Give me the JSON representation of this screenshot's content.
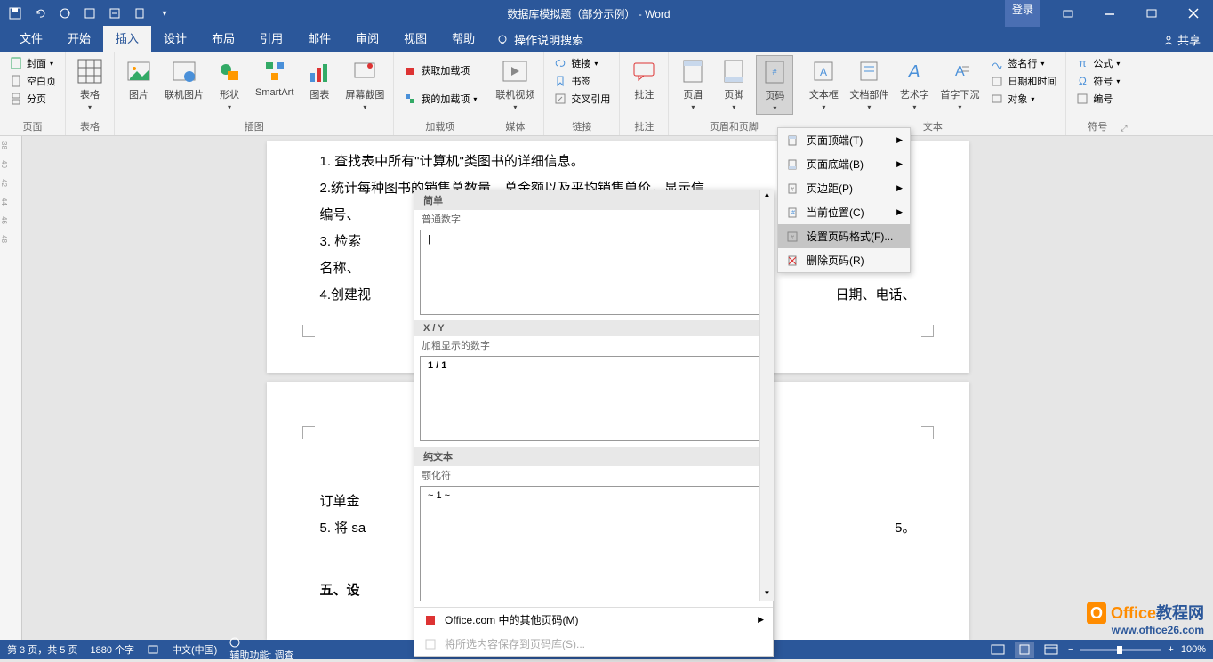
{
  "titlebar": {
    "doc_title": "数据库模拟题（部分示例）  -  Word",
    "login": "登录"
  },
  "tabs": {
    "file": "文件",
    "home": "开始",
    "insert": "插入",
    "design": "设计",
    "layout": "布局",
    "references": "引用",
    "mailings": "邮件",
    "review": "审阅",
    "view": "视图",
    "help": "帮助",
    "tellme": "操作说明搜索",
    "share": "共享"
  },
  "ribbon": {
    "pages": {
      "cover": "封面",
      "blank": "空白页",
      "break": "分页",
      "group": "页面"
    },
    "tables": {
      "table": "表格",
      "group": "表格"
    },
    "illustrations": {
      "pic": "图片",
      "online": "联机图片",
      "shapes": "形状",
      "smartart": "SmartArt",
      "chart": "图表",
      "screenshot": "屏幕截图",
      "group": "插图"
    },
    "addins": {
      "get": "获取加载项",
      "my": "我的加载项",
      "group": "加载项"
    },
    "media": {
      "video": "联机视频",
      "group": "媒体"
    },
    "links": {
      "link": "链接",
      "bookmark": "书签",
      "crossref": "交叉引用",
      "group": "链接"
    },
    "comments": {
      "comment": "批注",
      "group": "批注"
    },
    "headerfooter": {
      "header": "页眉",
      "footer": "页脚",
      "pagenumber": "页码",
      "group": "页眉和页脚"
    },
    "text": {
      "textbox": "文本框",
      "quickparts": "文档部件",
      "wordart": "艺术字",
      "dropcap": "首字下沉",
      "signature": "签名行",
      "datetime": "日期和时间",
      "object": "对象",
      "group": "文本"
    },
    "symbols": {
      "equation": "公式",
      "symbol": "符号",
      "number": "编号",
      "group": "符号"
    }
  },
  "pagenumber_menu": {
    "top": "页面顶端(T)",
    "bottom": "页面底端(B)",
    "margins": "页边距(P)",
    "current": "当前位置(C)",
    "format": "设置页码格式(F)...",
    "remove": "删除页码(R)"
  },
  "gallery": {
    "simple": "简单",
    "plain_number": "普通数字",
    "xy": "X / Y",
    "bold_number": "加粗显示的数字",
    "bold_sample": "1 / 1",
    "plaintext": "纯文本",
    "emdash": "颚化符",
    "tilde_sample": "~ 1 ~",
    "office_more": "Office.com 中的其他页码(M)",
    "save_selection": "将所选内容保存到页码库(S)..."
  },
  "document": {
    "line1": "1. 查找表中所有\"计算机\"类图书的详细信息。",
    "line2": "2.统计每种图书的销售总数量、总金额以及平均销售单价，显示信",
    "line2b": "编号、",
    "line3": "3. 检索",
    "line3b": "名称、",
    "line4": "4.创建视",
    "line4b": "日期、电话、",
    "page_num": "3",
    "line5": "订单金",
    "line6": "5. 将 sa",
    "line6b": "5。",
    "line7": "五、设"
  },
  "ruler": [
    "38",
    "40",
    "42",
    "44",
    "46",
    "48"
  ],
  "statusbar": {
    "page": "第 3 页，共 5 页",
    "words": "1880 个字",
    "lang_icon": "",
    "lang": "中文(中国)",
    "a11y": "辅助功能: 调查",
    "zoom": "100%"
  },
  "watermark": {
    "brand1": "Office",
    "brand2": "教程网",
    "url": "www.office26.com"
  }
}
